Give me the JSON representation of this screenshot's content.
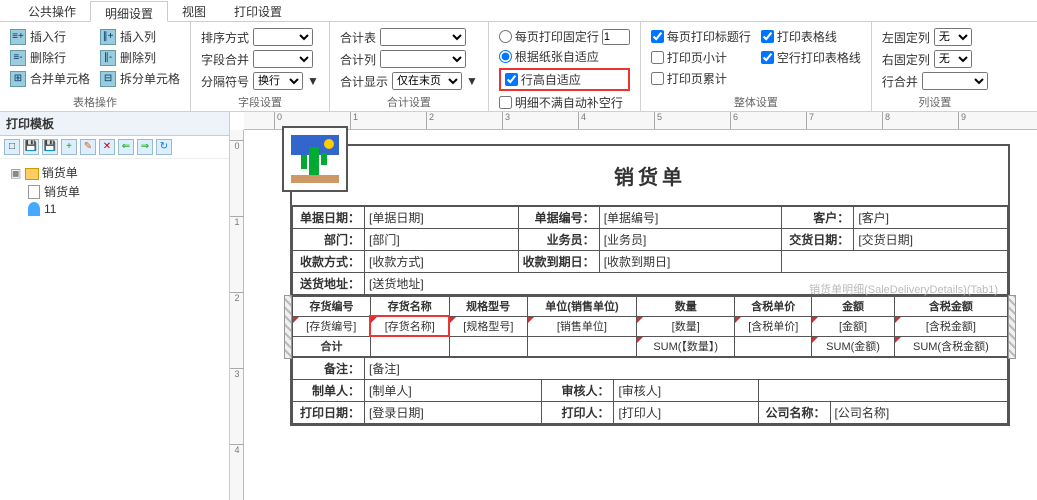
{
  "tabs": {
    "t0": "公共操作",
    "t1": "明细设置",
    "t2": "视图",
    "t3": "打印设置"
  },
  "group1": {
    "insertRow": "插入行",
    "insertCol": "插入列",
    "deleteRow": "删除行",
    "deleteCol": "删除列",
    "mergeCell": "合并单元格",
    "splitCell": "拆分单元格",
    "label": "表格操作"
  },
  "group2": {
    "sort": "排序方式",
    "fieldMerge": "字段合并",
    "sep": "分隔符号",
    "sepVal": "换行",
    "label": "字段设置"
  },
  "group3": {
    "sumTable": "合计表",
    "sumCol": "合计列",
    "sumShow": "合计显示",
    "sumShowVal": "仅在末页",
    "label": "合计设置"
  },
  "group4": {
    "fixedRows": "每页打印固定行",
    "fixedVal": "1",
    "autoPaper": "根据纸张自适应",
    "autoRowH": "行高自适应",
    "autoBlank": "明细不满自动补空行"
  },
  "group5": {
    "headerEach": "每页打印标题行",
    "pageSubtotal": "打印页小计",
    "pageTotal": "打印页累计",
    "gridOn": "打印表格线",
    "emptyGrid": "空行打印表格线",
    "label": "整体设置"
  },
  "group6": {
    "leftFix": "左固定列",
    "rightFix": "右固定列",
    "none": "无",
    "rowMerge": "行合并",
    "label": "列设置"
  },
  "sidebar": {
    "title": "打印模板",
    "root": "销货单",
    "n1": "销货单",
    "n2": "11"
  },
  "doc": {
    "title": "销货单",
    "r1c1l": "单据日期：",
    "r1c1v": "[单据日期]",
    "r1c2l": "单据编号：",
    "r1c2v": "[单据编号]",
    "r1c3l": "客户：",
    "r1c3v": "[客户]",
    "r2c1l": "部门：",
    "r2c1v": "[部门]",
    "r2c2l": "业务员：",
    "r2c2v": "[业务员]",
    "r2c3l": "交货日期：",
    "r2c3v": "[交货日期]",
    "r3c1l": "收款方式：",
    "r3c1v": "[收款方式]",
    "r3c2l": "收款到期日：",
    "r3c2v": "[收款到期日]",
    "r4c1l": "送货地址：",
    "r4c1v": "[送货地址]",
    "watermark": "销货单明细(SaleDeliveryDetails)(Tab1)",
    "h1": "存货编号",
    "h2": "存货名称",
    "h3": "规格型号",
    "h4": "单位(销售单位)",
    "h5": "数量",
    "h6": "含税单价",
    "h7": "金额",
    "h8": "含税金额",
    "d1": "[存货编号]",
    "d2": "[存货名称]",
    "d3": "[规格型号]",
    "d4": "[销售单位]",
    "d5": "[数量]",
    "d6": "[含税单价]",
    "d7": "[金额]",
    "d8": "[含税金额]",
    "sumRow": "合计",
    "s5": "SUM(【数量】)",
    "s7": "SUM(金额)",
    "s8": "SUM(含税金额)",
    "f1l": "备注：",
    "f1v": "[备注]",
    "f2l": "制单人：",
    "f2v": "[制单人]",
    "f2l2": "审核人：",
    "f2v2": "[审核人]",
    "f3l": "打印日期：",
    "f3v": "[登录日期]",
    "f3l2": "打印人：",
    "f3v2": "[打印人]",
    "f3l3": "公司名称：",
    "f3v3": "[公司名称]"
  }
}
